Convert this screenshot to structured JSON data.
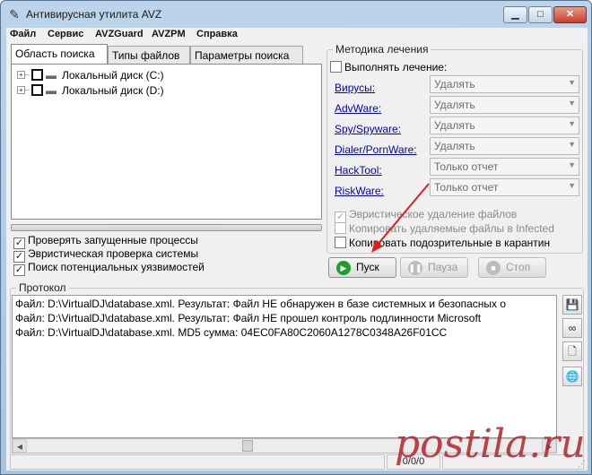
{
  "window": {
    "title": "Антивирусная утилита AVZ",
    "controls": {
      "minimize": "▁",
      "maximize": "□",
      "close": "✕"
    }
  },
  "menu": [
    "Файл",
    "Сервис",
    "AVZGuard",
    "AVZPM",
    "Справка"
  ],
  "tabs": [
    {
      "label": "Область поиска",
      "active": true
    },
    {
      "label": "Типы файлов",
      "active": false
    },
    {
      "label": "Параметры поиска",
      "active": false
    }
  ],
  "drives": [
    {
      "label": "Локальный диск (C:)",
      "checked": false
    },
    {
      "label": "Локальный диск (D:)",
      "checked": false
    }
  ],
  "progress": 0,
  "scan_options": [
    {
      "label": "Проверять запущенные процессы",
      "checked": true
    },
    {
      "label": "Эвристическая проверка системы",
      "checked": true
    },
    {
      "label": "Поиск потенциальных уязвимостей",
      "checked": true
    }
  ],
  "treatment": {
    "title": "Методика лечения",
    "perform_label": "Выполнять лечение:",
    "perform_checked": false,
    "rows": [
      {
        "category": "Вирусы:",
        "action": "Удалять"
      },
      {
        "category": "AdvWare:",
        "action": "Удалять"
      },
      {
        "category": "Spy/Spyware:",
        "action": "Удалять"
      },
      {
        "category": "Dialer/PornWare:",
        "action": "Удалять"
      },
      {
        "category": "HackTool:",
        "action": "Только отчет"
      },
      {
        "category": "RiskWare:",
        "action": "Только отчет"
      }
    ],
    "options": [
      {
        "label": "Эвристическое удаление файлов",
        "checked": true,
        "disabled": true
      },
      {
        "label": "Копировать удаляемые файлы в  Infected",
        "checked": false,
        "disabled": true
      },
      {
        "label": "Копировать подозрительные в  карантин",
        "checked": false,
        "disabled": false
      }
    ]
  },
  "buttons": {
    "start": "Пуск",
    "pause": "Пауза",
    "stop": "Стоп"
  },
  "protocol": {
    "title": "Протокол",
    "lines": [
      "Файл: D:\\VirtualDJ\\database.xml. Результат: Файл НЕ обнаружен в базе системных и безопасных о",
      "Файл: D:\\VirtualDJ\\database.xml. Результат: Файл НЕ прошел контроль подлинности Microsoft",
      "Файл: D:\\VirtualDJ\\database.xml. MD5 сумма: 04EC0FA80C2060A1278C0348A26F01CC"
    ]
  },
  "status": {
    "counter": "0/0/0"
  },
  "watermark": "postila.ru",
  "colors": {
    "link": "#0000cc",
    "start_icon": "#1f9d2e",
    "watermark": "#b3242b",
    "arrow": "#e0201b"
  }
}
